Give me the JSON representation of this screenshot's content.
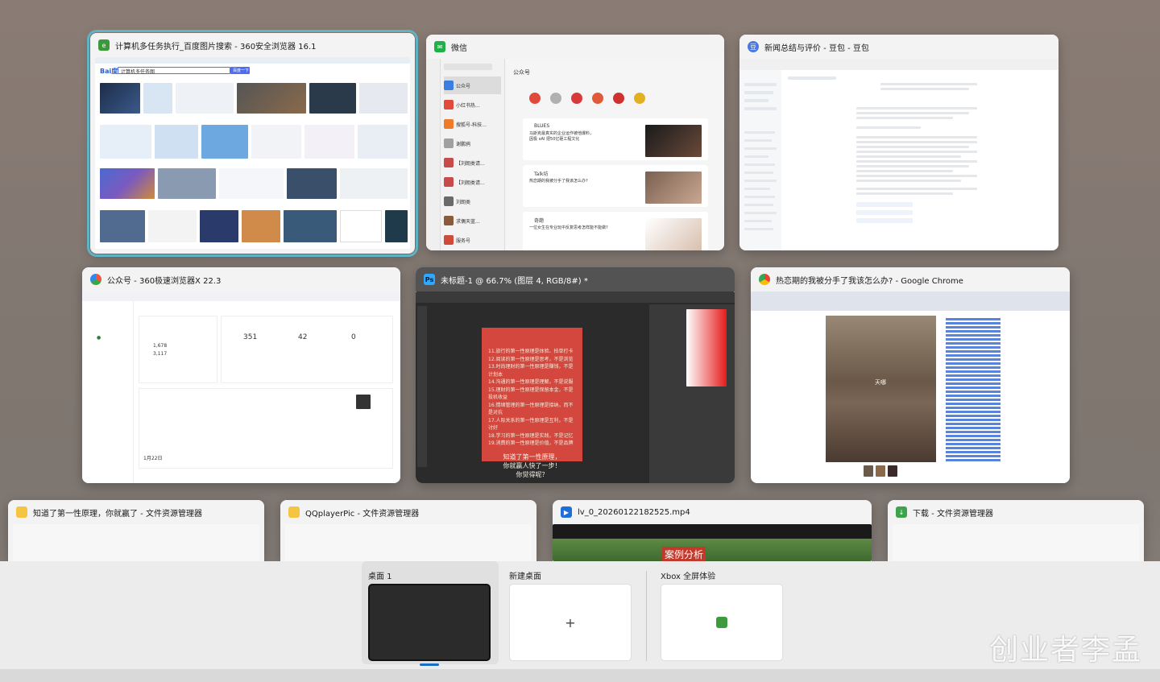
{
  "windows": {
    "w1": {
      "title": "计算机多任务执行_百度图片搜索 - 360安全浏览器 16.1",
      "search": "计算机多任务图",
      "btn": "百度一下"
    },
    "w2": {
      "title": "微信",
      "chat_title": "公众号",
      "list": [
        {
          "name": "公众号",
          "time": "16:16"
        },
        {
          "name": "小红书热...",
          "time": "昨天 20:09"
        },
        {
          "name": "搜狐号-科技...",
          "time": "昨天 18:54"
        },
        {
          "name": "谢鹏鸦",
          "time": "昨天 18:09"
        },
        {
          "name": "【刘朗类请...",
          "time": "昨天 14:41"
        },
        {
          "name": "【刘朗类请...",
          "time": "昨天 14:41"
        },
        {
          "name": "刘朗类",
          "time": "昨天 09:03"
        },
        {
          "name": "求偶天蓝...",
          "time": "昨天 21:25"
        },
        {
          "name": "服务号",
          "time": "昨天 20:59"
        }
      ],
      "cards": [
        {
          "author": "BLUES",
          "text": "马斯克最真实的企业运作被他爆料，因极 xAI 把50亿砸工程文化",
          "time": "12:38"
        },
        {
          "author": "Talk坊",
          "text": "热恋期的我被分手了我该怎么办?",
          "time": "13:50"
        },
        {
          "author": "奇葩",
          "text": "一位女生在专业玩中反复思考怎样能不能做?",
          "time": "13:18"
        }
      ]
    },
    "w3": {
      "title": "新闻总结与评价 - 豆包 - 豆包"
    },
    "w4": {
      "title": "公众号 - 360极速浏览器X 22.3",
      "stats": [
        "351",
        "42",
        "0"
      ],
      "count1": "1,678",
      "count2": "3,117",
      "date": "1月22日"
    },
    "w5": {
      "title": "未标题-1 @ 66.7% (图层 4, RGB/8#) *",
      "lines": [
        "11.旅行的第一性原理是体验、拍单打卡",
        "12.阅读的第一性原理是思考，不是浏览",
        "13.时尚理财的第一性原理是赚钱，不是计划本",
        "14.沟通的第一性原理是理解，不是说服",
        "15.理财的第一性原理是保留本金，不是投机收益",
        "16.情绪管理的第一性原理是接纳，而不是对抗",
        "17.人际关系的第一性原理是互利，不是讨好",
        "18.学习的第一性原理是实践，不是记忆",
        "19.消费的第一性原理是价值，不是品牌"
      ],
      "highlight": [
        "知道了第一性原理，",
        "你就赢人快了一步！",
        "你觉得呢？"
      ]
    },
    "w6": {
      "title": "热恋期的我被分手了我该怎么办? - Google Chrome",
      "caption": "天哪"
    },
    "w7": {
      "title": "知道了第一性原理，你就赢了 - 文件资源管理器"
    },
    "w8": {
      "title": "QQplayerPic - 文件资源管理器"
    },
    "w9": {
      "title": "lv_0_20260122182525.mp4",
      "overlay": "案例分析"
    },
    "w10": {
      "title": "下载 - 文件资源管理器"
    }
  },
  "desktops": {
    "d1": "桌面 1",
    "new": "新建桌面",
    "xbox": "Xbox 全屏体验",
    "plus": "+"
  },
  "watermark": "创业者李孟"
}
